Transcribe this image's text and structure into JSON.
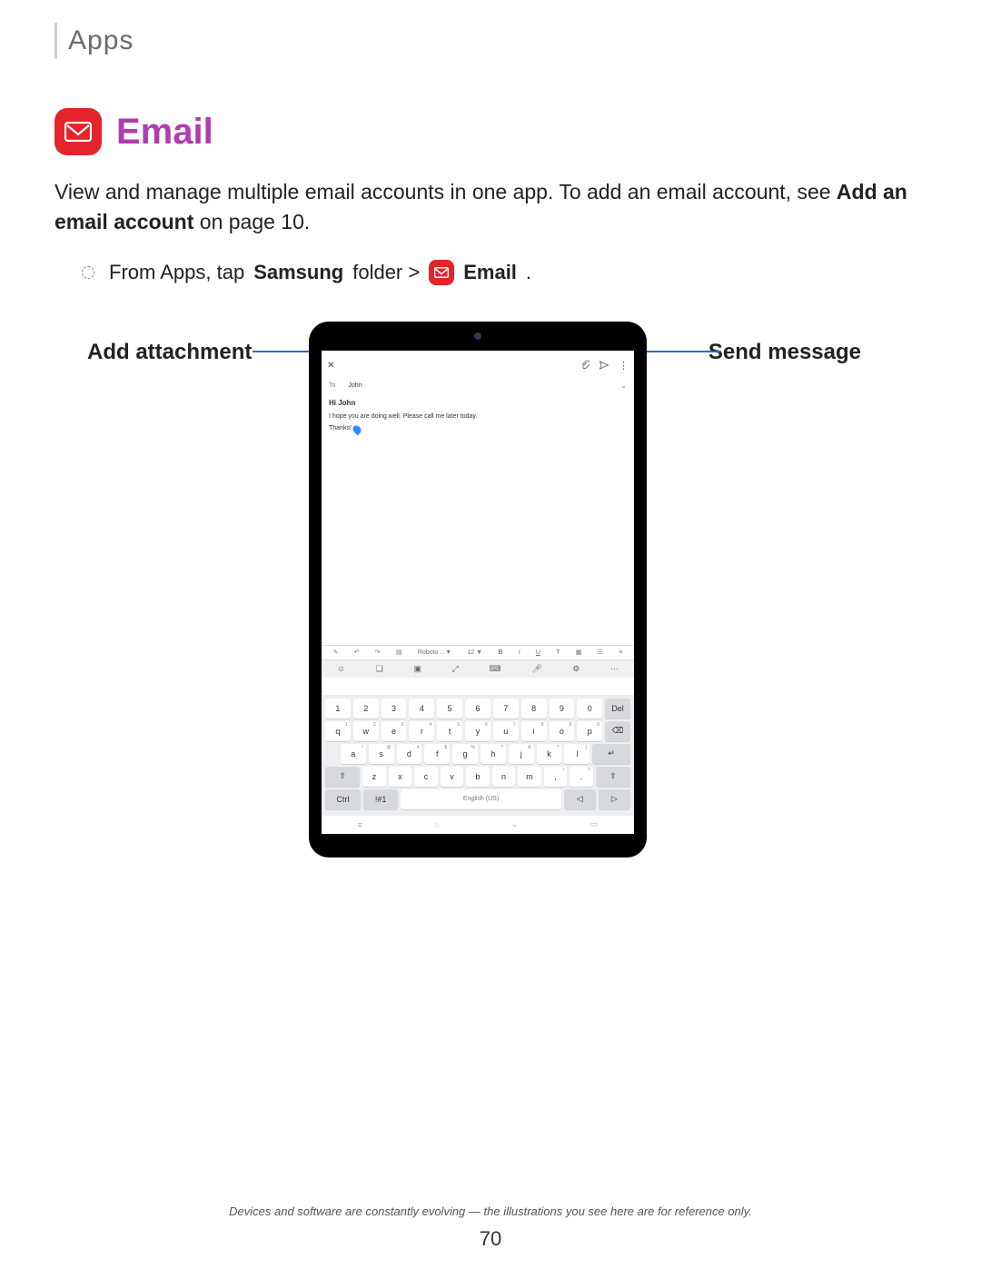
{
  "breadcrumb": "Apps",
  "title": "Email",
  "intro_prefix": "View and manage multiple email accounts in one app. To add an email account, see ",
  "intro_bold": "Add an email account",
  "intro_suffix": " on page 10.",
  "step": {
    "prefix": "From Apps, tap ",
    "bold1": "Samsung",
    "mid": " folder > ",
    "bold2": "Email",
    "suffix": "."
  },
  "callouts": {
    "left": "Add attachment",
    "right": "Send message"
  },
  "compose": {
    "to_label": "To",
    "recipient": "John",
    "subject": "Hi John",
    "body_line": "I hope you are doing well. Please call me later today.",
    "body_sign": "Thanks!"
  },
  "format_bar": {
    "font": "Roboto .. ▼",
    "size": "12 ▼",
    "b": "B",
    "i": "I",
    "u": "U",
    "t": "T"
  },
  "keyboard": {
    "row_num": [
      "1",
      "2",
      "3",
      "4",
      "5",
      "6",
      "7",
      "8",
      "9",
      "0"
    ],
    "row_del": "Del",
    "row_q": [
      [
        "q",
        "1"
      ],
      [
        "w",
        "2"
      ],
      [
        "e",
        "3"
      ],
      [
        "r",
        "4"
      ],
      [
        "t",
        "5"
      ],
      [
        "y",
        "6"
      ],
      [
        "u",
        "7"
      ],
      [
        "i",
        "8"
      ],
      [
        "o",
        "9"
      ],
      [
        "p",
        "0"
      ]
    ],
    "row_a": [
      [
        "a",
        "!"
      ],
      [
        "s",
        "@"
      ],
      [
        "d",
        "#"
      ],
      [
        "f",
        "$"
      ],
      [
        "g",
        "%"
      ],
      [
        "h",
        "^"
      ],
      [
        "j",
        "&"
      ],
      [
        "k",
        "*"
      ],
      [
        "l",
        "("
      ]
    ],
    "row_z": [
      [
        "z",
        ""
      ],
      [
        "x",
        ""
      ],
      [
        "c",
        ""
      ],
      [
        "v",
        ""
      ],
      [
        "b",
        ""
      ],
      [
        "n",
        ""
      ],
      [
        "m",
        ""
      ],
      [
        ",",
        "!"
      ],
      [
        ".",
        "?"
      ]
    ],
    "shift": "⇧",
    "enter": "↵",
    "bksp": "⌫",
    "ctrl": "Ctrl",
    "sym": "!#1",
    "space": "English (US)",
    "left": "◁",
    "right": "▷"
  },
  "footer": "Devices and software are constantly evolving — the illustrations you see here are for reference only.",
  "page_number": "70"
}
